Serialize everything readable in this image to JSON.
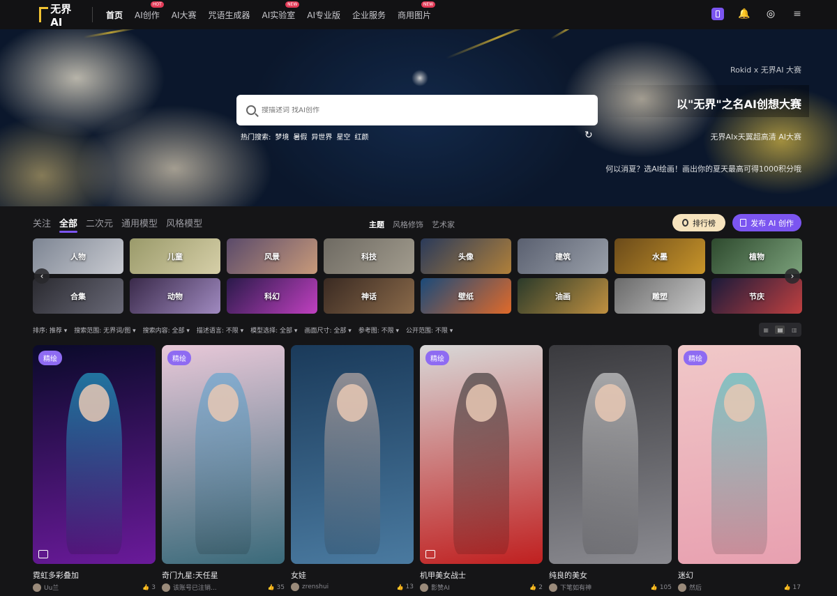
{
  "logo": {
    "text": "无界AI"
  },
  "nav": {
    "items": [
      {
        "label": "首页",
        "badge": ""
      },
      {
        "label": "AI创作",
        "badge": "HOT"
      },
      {
        "label": "AI大赛",
        "badge": ""
      },
      {
        "label": "咒语生成器",
        "badge": ""
      },
      {
        "label": "AI实验室",
        "badge": "NEW"
      },
      {
        "label": "AI专业版",
        "badge": ""
      },
      {
        "label": "企业服务",
        "badge": ""
      },
      {
        "label": "商用图片",
        "badge": "NEW"
      }
    ]
  },
  "top_icons": {
    "phone": "phone-icon",
    "bell": "🔔",
    "avatar": "◎",
    "menu": "≡"
  },
  "hero": {
    "search_placeholder": "搜描述词 找AI创作",
    "hot_label": "热门搜索:",
    "hot_terms": [
      "梦境",
      "暑假",
      "异世界",
      "星空",
      "红颜"
    ],
    "refresh": "↻",
    "sub1": "Rokid x 无界AI 大赛",
    "title": "以\"无界\"之名AI创想大赛",
    "sub2": "无界AIx天翼超高清 AI大赛",
    "sub3": "何以消夏？选AI绘画！画出你的夏天最高可得1000积分哦"
  },
  "tabs_left": [
    "关注",
    "全部",
    "二次元",
    "通用模型",
    "风格模型"
  ],
  "tabs_center": [
    "主题",
    "风格修饰",
    "艺术家"
  ],
  "buttons": {
    "rank": "排行榜",
    "publish": "发布 AI 创作"
  },
  "categories": [
    {
      "label": "人物",
      "color1": "#7d8593",
      "color2": "#c9cbd1"
    },
    {
      "label": "儿童",
      "color1": "#9a9a6a",
      "color2": "#d6cfa8"
    },
    {
      "label": "风景",
      "color1": "#5a4a6a",
      "color2": "#c89a7a"
    },
    {
      "label": "科技",
      "color1": "#6e6a62",
      "color2": "#a29c8e"
    },
    {
      "label": "头像",
      "color1": "#2a3a5a",
      "color2": "#b0803a"
    },
    {
      "label": "建筑",
      "color1": "#5a6070",
      "color2": "#9aa0aa"
    },
    {
      "label": "水墨",
      "color1": "#6a4a1a",
      "color2": "#c8952a"
    },
    {
      "label": "植物",
      "color1": "#2e4a2e",
      "color2": "#7aa07a"
    },
    {
      "label": "合集",
      "color1": "#2a2a30",
      "color2": "#6a6a78"
    },
    {
      "label": "动物",
      "color1": "#3a2a4a",
      "color2": "#a08ac0"
    },
    {
      "label": "科幻",
      "color1": "#2a1a4a",
      "color2": "#c040c0"
    },
    {
      "label": "神话",
      "color1": "#3a2a22",
      "color2": "#8a6a4a"
    },
    {
      "label": "壁纸",
      "color1": "#1a4a7a",
      "color2": "#e06a2a"
    },
    {
      "label": "油画",
      "color1": "#2a3a2a",
      "color2": "#c09040"
    },
    {
      "label": "雕塑",
      "color1": "#6a6a6a",
      "color2": "#c8c8c8"
    },
    {
      "label": "节庆",
      "color1": "#1a1a3a",
      "color2": "#c04040"
    }
  ],
  "arrows": {
    "left": "‹",
    "right": "›"
  },
  "filters": [
    "排序: 推荐 ▾",
    "搜索范围: 无界词/图 ▾",
    "搜索内容: 全部 ▾",
    "描述语言: 不限 ▾",
    "模型选择: 全部 ▾",
    "画面尺寸: 全部 ▾",
    "参考图: 不限 ▾",
    "公开范围: 不限 ▾"
  ],
  "view_toggle": [
    "▦",
    "▤",
    "▥"
  ],
  "cards": [
    {
      "title": "霓虹多彩叠加",
      "author": "Uu兰",
      "likes": "3",
      "badge": "精绘",
      "bg1": "#0a0a2a",
      "bg2": "#6a1a9a",
      "accent": "#28c8f0"
    },
    {
      "title": "奇门九星:天任星",
      "author": "该账号已注销...",
      "likes": "35",
      "badge": "精绘",
      "bg1": "#e8c8d8",
      "bg2": "#3a6a7a",
      "accent": "#4aa0d0"
    },
    {
      "title": "女娃",
      "author": "zrenshui",
      "likes": "13",
      "badge": "",
      "bg1": "#1a3a5a",
      "bg2": "#4a7aa0",
      "accent": "#e8c8b8"
    },
    {
      "title": "机甲美女战士",
      "author": "影赞AI",
      "likes": "2",
      "badge": "精绘",
      "bg1": "#d8d8d8",
      "bg2": "#c02020",
      "accent": "#1a1a1a"
    },
    {
      "title": "纯良的美女",
      "author": "下笔如有神",
      "likes": "105",
      "badge": "",
      "bg1": "#3a3a3e",
      "bg2": "#8a8a90",
      "accent": "#f4f4f4"
    },
    {
      "title": "迷幻",
      "author": "然后",
      "likes": "17",
      "badge": "精绘",
      "bg1": "#f0c8c8",
      "bg2": "#e8a0b0",
      "accent": "#30c0c0"
    }
  ],
  "like_icon": "👍"
}
